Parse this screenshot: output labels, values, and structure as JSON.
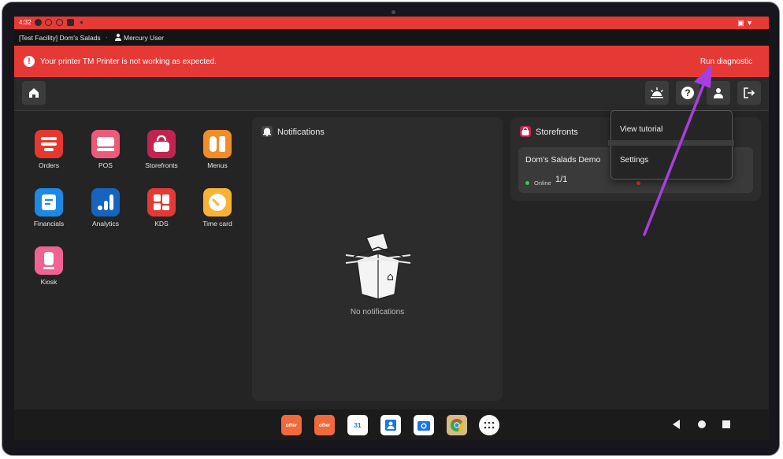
{
  "status_bar": {
    "time": "4:32"
  },
  "facility_bar": {
    "facility": "[Test Facility] Dom's Salads",
    "separator": "·",
    "user": "Mercury User"
  },
  "alert": {
    "message": "Your printer TM Printer is not working as expected.",
    "action": "Run diagnostic"
  },
  "apps": [
    {
      "label": "Orders",
      "color": "#e5392f"
    },
    {
      "label": "POS",
      "color": "#ef5a7a"
    },
    {
      "label": "Storefronts",
      "color": "#c2244f"
    },
    {
      "label": "Menus",
      "color": "#f28c28"
    },
    {
      "label": "Financials",
      "color": "#1e88e5"
    },
    {
      "label": "Analytics",
      "color": "#1565c0"
    },
    {
      "label": "KDS",
      "color": "#e53935"
    },
    {
      "label": "Time card",
      "color": "#f9b233"
    },
    {
      "label": "Kiosk",
      "color": "#f06292"
    }
  ],
  "notifications": {
    "title": "Notifications",
    "empty": "No notifications"
  },
  "storefronts": {
    "title": "Storefronts",
    "store_name": "Dom's Salads Demo",
    "status": "Online",
    "count": "1/1"
  },
  "dropdown": {
    "items": [
      "View tutorial",
      "Settings"
    ]
  },
  "dock": {
    "offer_label": "offer",
    "calendar_label": "31"
  },
  "colors": {
    "alert_red": "#e53935",
    "annotation_arrow": "#a83ee0"
  }
}
